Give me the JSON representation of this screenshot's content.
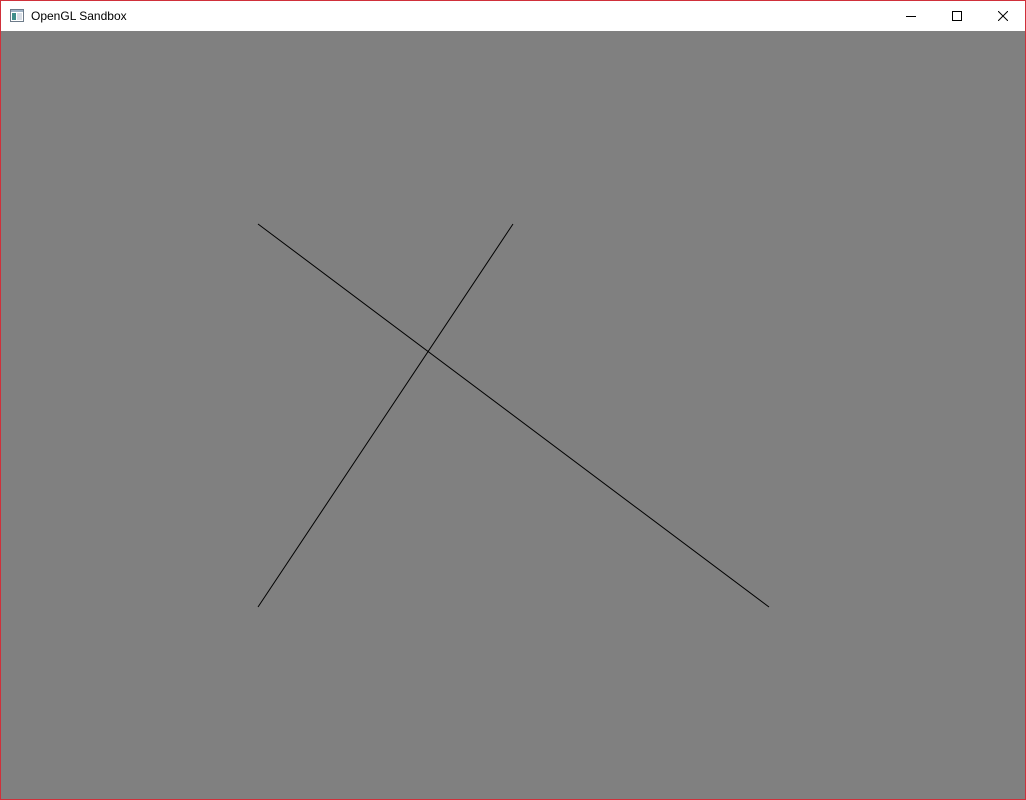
{
  "window": {
    "title": "OpenGL Sandbox",
    "app_icon": "window-app-icon",
    "controls": [
      {
        "name": "minimize",
        "icon": "minimize-icon"
      },
      {
        "name": "maximize",
        "icon": "maximize-icon"
      },
      {
        "name": "close",
        "icon": "close-icon"
      }
    ],
    "border_color": "#d0303a"
  },
  "viewport": {
    "clear_color": "#808080",
    "line_color": "#000000"
  }
}
